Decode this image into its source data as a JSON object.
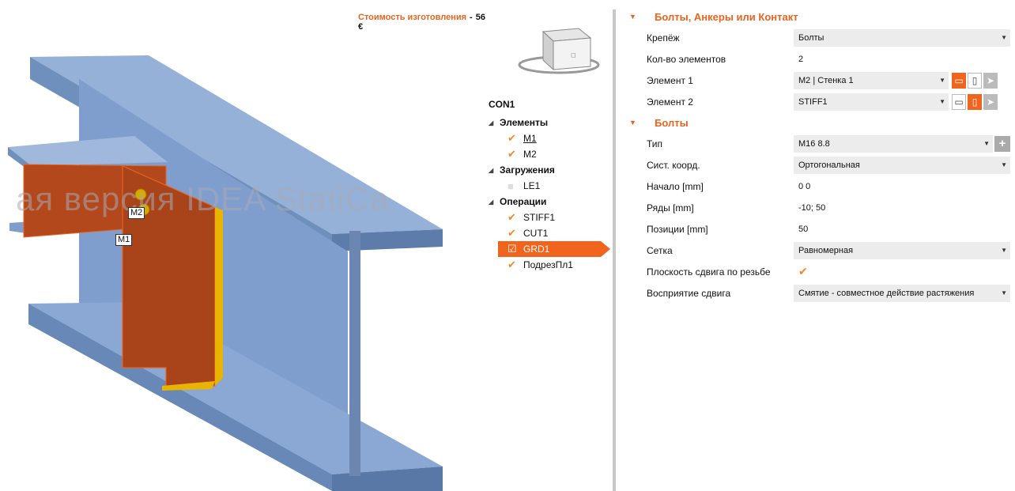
{
  "cost": {
    "label": "Стоимость изготовления",
    "dash": "-",
    "value": "56 €"
  },
  "watermark": "ая версия IDEA StatiCa",
  "labels3d": {
    "m2": "M2",
    "m1": "M1"
  },
  "tree": {
    "root": "CON1",
    "groups": [
      {
        "label": "Элементы",
        "items": [
          {
            "label": "M1",
            "checked": true
          },
          {
            "label": "M2",
            "checked": true
          }
        ]
      },
      {
        "label": "Загружения",
        "items": [
          {
            "label": "LE1",
            "checked": false
          }
        ]
      },
      {
        "label": "Операции",
        "items": [
          {
            "label": "STIFF1",
            "checked": true
          },
          {
            "label": "CUT1",
            "checked": true
          },
          {
            "label": "GRD1",
            "checked": true,
            "selected": true
          },
          {
            "label": "ПодрезПл1",
            "checked": true
          }
        ]
      }
    ]
  },
  "panel": {
    "section1": "Болты, Анкеры или Контакт",
    "fastener_label": "Крепёж",
    "fastener_value": "Болты",
    "count_label": "Кол-во элементов",
    "count_value": "2",
    "el1_label": "Элемент 1",
    "el1_value": "M2 | Стенка 1",
    "el2_label": "Элемент 2",
    "el2_value": "STIFF1",
    "section2": "Болты",
    "type_label": "Тип",
    "type_value": "M16 8.8",
    "coord_label": "Сист. коорд.",
    "coord_value": "Ортогональная",
    "start_label": "Начало [mm]",
    "start_value": "0 0",
    "rows_label": "Ряды [mm]",
    "rows_value": "-10; 50",
    "pos_label": "Позиции [mm]",
    "pos_value": "50",
    "grid_label": "Сетка",
    "grid_value": "Равномерная",
    "shear_label": "Плоскость сдвига по резьбе",
    "shear_checked": true,
    "transfer_label": "Восприятие сдвига",
    "transfer_value": "Смятие - совместное действие растяжения"
  },
  "colors": {
    "accent": "#f0641e",
    "steel": "#7a9bc8",
    "plate": "#b0461a",
    "weld": "#e8b400"
  }
}
